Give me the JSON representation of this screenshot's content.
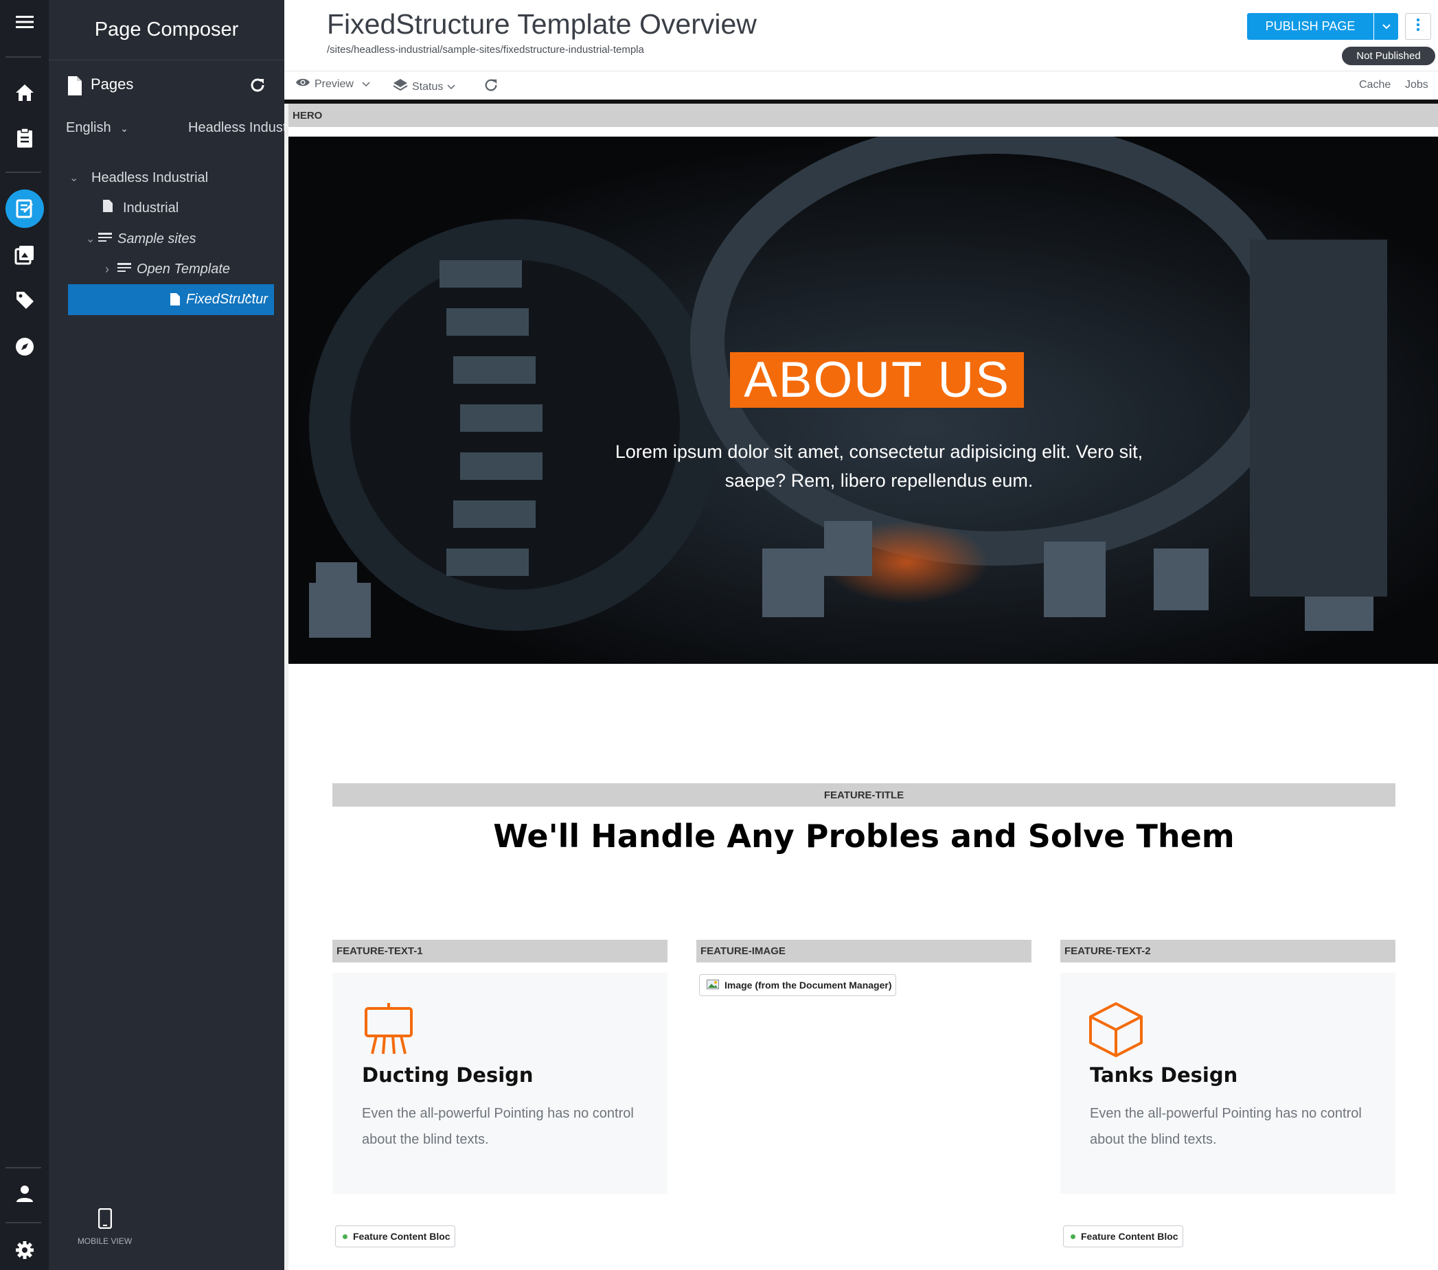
{
  "app": {
    "panel_title": "Page Composer",
    "mobile_view": "MOBILE VIEW"
  },
  "pages_header": {
    "label": "Pages"
  },
  "filters": {
    "language": "English",
    "site": "Headless Industrial"
  },
  "tree": {
    "items": [
      {
        "label": "Headless Industrial"
      },
      {
        "label": "Industrial"
      },
      {
        "label": "Sample sites"
      },
      {
        "label": "Open Template"
      },
      {
        "label": "FixedStructur"
      }
    ]
  },
  "header": {
    "title": "FixedStructure Template Overview",
    "path": "/sites/headless-industrial/sample-sites/fixedstructure-industrial-templa",
    "publish_label": "PUBLISH PAGE",
    "status": "Not Published"
  },
  "toolbar": {
    "preview": "Preview",
    "status": "Status",
    "cache": "Cache",
    "jobs": "Jobs"
  },
  "canvas": {
    "hero_label": "HERO",
    "hero_title": "ABOUT US",
    "hero_text": "Lorem ipsum dolor sit amet, consectetur adipisicing elit. Vero sit, saepe? Rem, libero repellendus eum.",
    "feature_title_label": "FEATURE-TITLE",
    "feature_title": "We'll Handle Any Probles and Solve Them",
    "feature_text1_label": "FEATURE-TEXT-1",
    "feature_image_label": "FEATURE-IMAGE",
    "feature_text2_label": "FEATURE-TEXT-2",
    "image_chip": "Image (from the Document Manager)",
    "card1": {
      "title": "Ducting Design",
      "text": "Even the all-powerful Pointing has no control about the blind texts.",
      "icon": "easel-icon"
    },
    "card2": {
      "title": "Tanks Design",
      "text": "Even the all-powerful Pointing has no control about the blind texts.",
      "icon": "cube-icon"
    },
    "chip1": "Feature Content Bloc",
    "chip2": "Feature Content Bloc"
  },
  "colors": {
    "accent": "#0f9ae8",
    "orange": "#f46b0b",
    "sidebar": "#272b33",
    "rail": "#1b1e24",
    "selected": "#1175c0"
  }
}
